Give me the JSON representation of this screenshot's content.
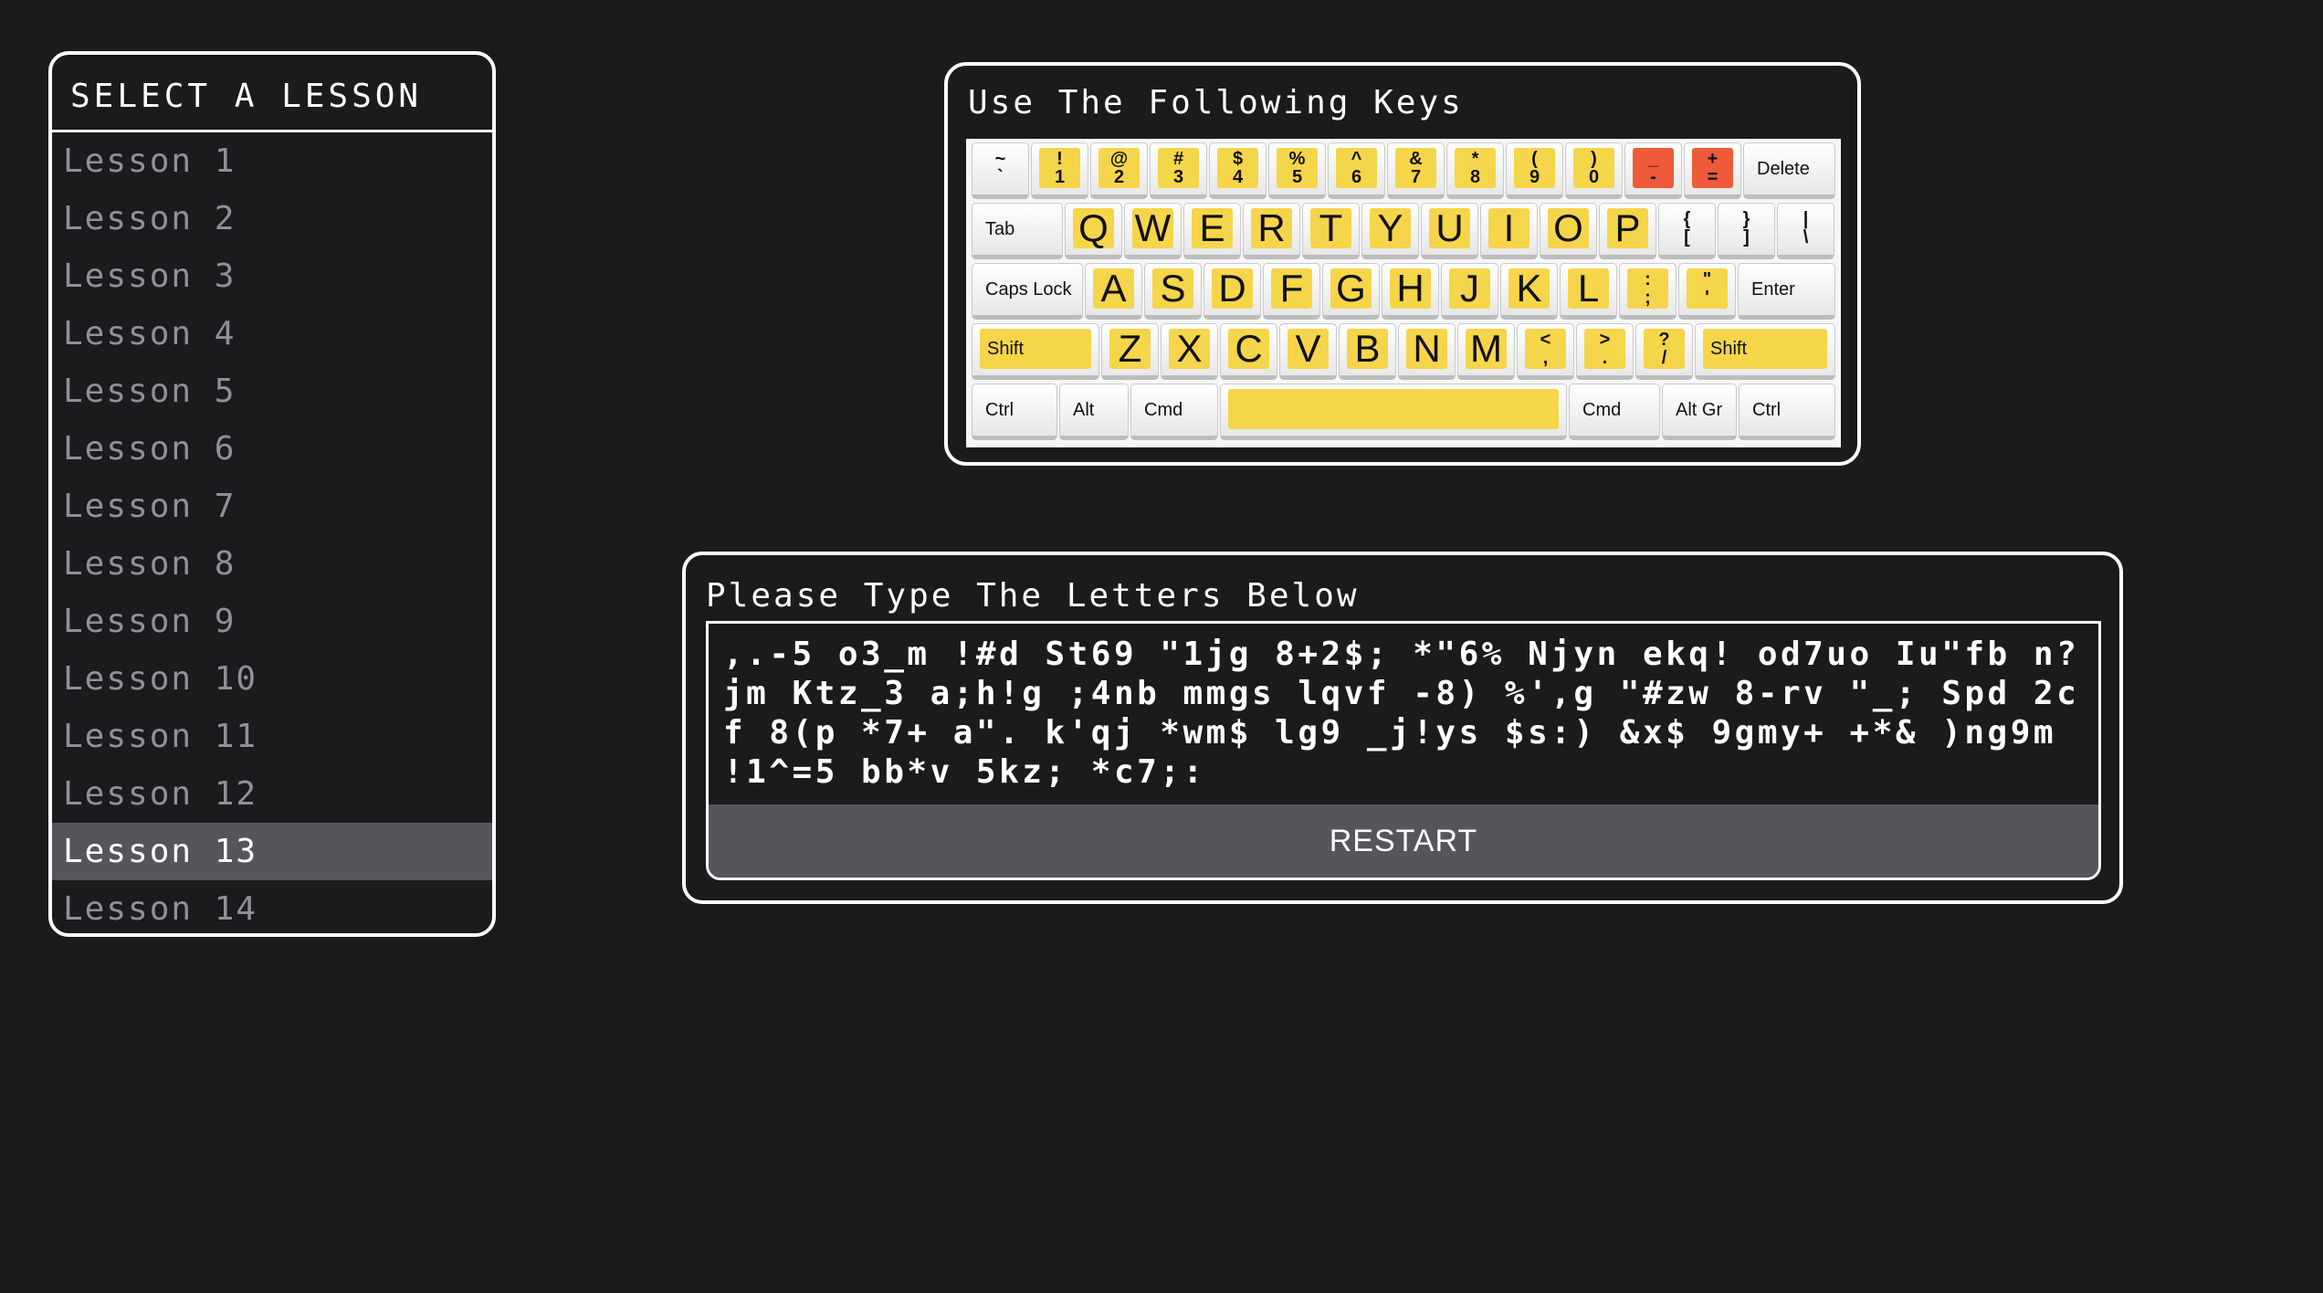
{
  "lesson_panel": {
    "title": "SELECT A LESSON",
    "items": [
      {
        "label": "Lesson 1"
      },
      {
        "label": "Lesson 2"
      },
      {
        "label": "Lesson 3"
      },
      {
        "label": "Lesson 4"
      },
      {
        "label": "Lesson 5"
      },
      {
        "label": "Lesson 6"
      },
      {
        "label": "Lesson 7"
      },
      {
        "label": "Lesson 8"
      },
      {
        "label": "Lesson 9"
      },
      {
        "label": "Lesson 10"
      },
      {
        "label": "Lesson 11"
      },
      {
        "label": "Lesson 12"
      },
      {
        "label": "Lesson 13"
      },
      {
        "label": "Lesson 14"
      }
    ],
    "selected_label": "Lesson 13"
  },
  "keys_panel": {
    "title": "Use The Following Keys",
    "keyboard": {
      "number_row": [
        {
          "top": "~",
          "bottom": "`"
        },
        {
          "top": "!",
          "bottom": "1"
        },
        {
          "top": "@",
          "bottom": "2"
        },
        {
          "top": "#",
          "bottom": "3"
        },
        {
          "top": "$",
          "bottom": "4"
        },
        {
          "top": "%",
          "bottom": "5"
        },
        {
          "top": "^",
          "bottom": "6"
        },
        {
          "top": "&",
          "bottom": "7"
        },
        {
          "top": "*",
          "bottom": "8"
        },
        {
          "top": "(",
          "bottom": "9"
        },
        {
          "top": ")",
          "bottom": "0"
        },
        {
          "top": "_",
          "bottom": "-"
        },
        {
          "top": "+",
          "bottom": "="
        }
      ],
      "delete": "Delete",
      "tab": "Tab",
      "top_row": [
        "Q",
        "W",
        "E",
        "R",
        "T",
        "Y",
        "U",
        "I",
        "O",
        "P"
      ],
      "top_row_symbols": [
        {
          "top": "{",
          "bottom": "["
        },
        {
          "top": "}",
          "bottom": "]"
        },
        {
          "top": "|",
          "bottom": "\\"
        }
      ],
      "caps_lock": "Caps Lock",
      "home_row": [
        "A",
        "S",
        "D",
        "F",
        "G",
        "H",
        "J",
        "K",
        "L"
      ],
      "home_row_symbols": [
        {
          "top": ":",
          "bottom": ";"
        },
        {
          "top": "\"",
          "bottom": "'"
        }
      ],
      "enter": "Enter",
      "shift": "Shift",
      "bottom_row": [
        "Z",
        "X",
        "C",
        "V",
        "B",
        "N",
        "M"
      ],
      "bottom_row_symbols": [
        {
          "top": "<",
          "bottom": ","
        },
        {
          "top": ">",
          "bottom": "."
        },
        {
          "top": "?",
          "bottom": "/"
        }
      ],
      "ctrl": "Ctrl",
      "alt": "Alt",
      "cmd": "Cmd",
      "alt_gr": "Alt Gr",
      "highlight_color": "#f5d54a",
      "accent_color": "#ee5a3a"
    }
  },
  "type_panel": {
    "title": "Please Type The Letters Below",
    "text": ",.-5 o3_m !#d St69 \"1jg 8+2$; *\"6% Njyn ekq! od7uo Iu\"fb n?jm Ktz_3 a;h!g ;4nb mmgs lqvf -8) %',g \"#zw 8-rv \"_; Spd 2cf 8(p *7+ a\". k'qj *wm$ lg9 _j!ys $s:) &x$ 9gmy+ +*& )ng9m !1^=5 bb*v 5kz; *c7;:",
    "restart_label": "RESTART"
  }
}
